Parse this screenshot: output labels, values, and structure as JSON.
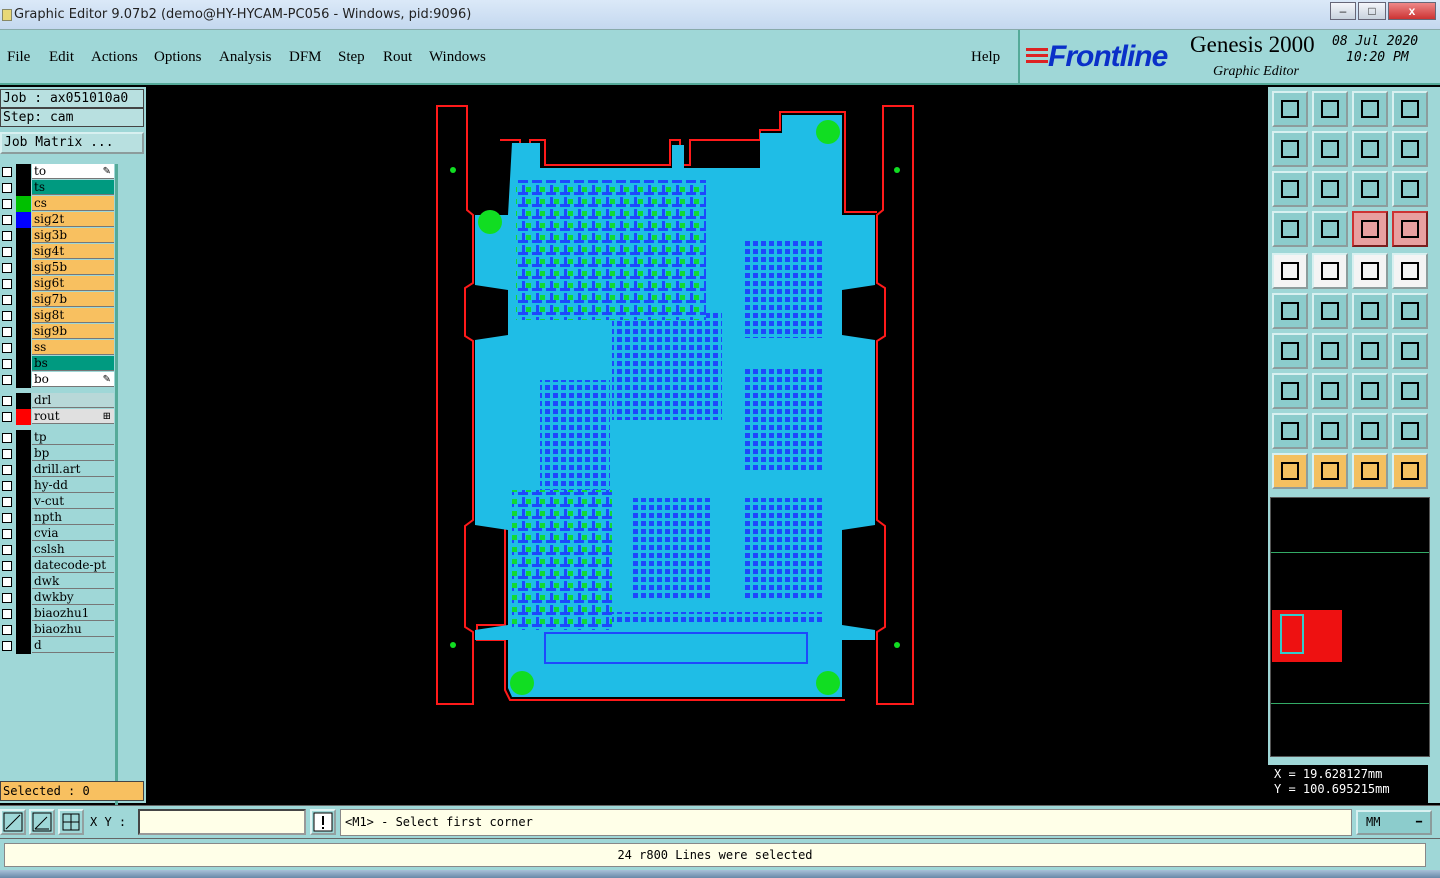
{
  "window": {
    "title": "Graphic Editor 9.07b2 (demo@HY-HYCAM-PC056 - Windows, pid:9096)",
    "minimize": "–",
    "maximize": "□",
    "close": "x"
  },
  "menu": {
    "file": "File",
    "edit": "Edit",
    "actions": "Actions",
    "options": "Options",
    "analysis": "Analysis",
    "dfm": "DFM",
    "step": "Step",
    "rout": "Rout",
    "windows": "Windows",
    "help": "Help"
  },
  "brand": {
    "logo": "Frontline",
    "product": "Genesis 2000",
    "module": "Graphic Editor",
    "date": "08 Jul 2020",
    "time": "10:20 PM"
  },
  "job": {
    "job_line": "Job : ax051010a0",
    "step_line": "Step: cam",
    "matrix_button": "Job Matrix ..."
  },
  "layers": [
    {
      "name": "to",
      "color": "#ffffff",
      "swatch": "#000000",
      "flag": "pen"
    },
    {
      "name": "ts",
      "color": "#009a80",
      "swatch": "#000000"
    },
    {
      "name": "cs",
      "color": "#f8c060",
      "swatch": "#00c000"
    },
    {
      "name": "sig2t",
      "color": "#f8c060",
      "swatch": "#0000ff"
    },
    {
      "name": "sig3b",
      "color": "#f8c060",
      "swatch": "#000000"
    },
    {
      "name": "sig4t",
      "color": "#f8c060",
      "swatch": "#000000"
    },
    {
      "name": "sig5b",
      "color": "#f8c060",
      "swatch": "#000000"
    },
    {
      "name": "sig6t",
      "color": "#f8c060",
      "swatch": "#000000"
    },
    {
      "name": "sig7b",
      "color": "#f8c060",
      "swatch": "#000000"
    },
    {
      "name": "sig8t",
      "color": "#f8c060",
      "swatch": "#000000"
    },
    {
      "name": "sig9b",
      "color": "#f8c060",
      "swatch": "#000000"
    },
    {
      "name": "ss",
      "color": "#f8c060",
      "swatch": "#000000"
    },
    {
      "name": "bs",
      "color": "#009a80",
      "swatch": "#000000"
    },
    {
      "name": "bo",
      "color": "#ffffff",
      "swatch": "#000000",
      "flag": "pen"
    }
  ],
  "drill_layers": [
    {
      "name": "drl",
      "color": "#b8d8d8",
      "swatch": "#000000"
    },
    {
      "name": "rout",
      "color": "#e0e0e0",
      "swatch": "#ff0000",
      "flag": "grid"
    }
  ],
  "misc_layers": [
    {
      "name": "tp"
    },
    {
      "name": "bp"
    },
    {
      "name": "drill.art"
    },
    {
      "name": "hy-dd"
    },
    {
      "name": "v-cut"
    },
    {
      "name": "npth"
    },
    {
      "name": "cvia"
    },
    {
      "name": "cslsh"
    },
    {
      "name": "datecode-pt"
    },
    {
      "name": "dwk"
    },
    {
      "name": "dwkby"
    },
    {
      "name": "biaozhu1"
    },
    {
      "name": "biaozhu"
    },
    {
      "name": "d"
    }
  ],
  "selected": "Selected : 0",
  "coords": {
    "x": "X  =  19.628127mm",
    "y": "Y  =  100.695215mm"
  },
  "status": {
    "xy_label": "X Y :",
    "xy_value": "",
    "prompt": "<M1> - Select first corner",
    "unit": "MM",
    "unit_arrow": "━",
    "result": "24 r800 Lines were selected"
  },
  "toolbar_groups": {
    "view": [
      "home-icon",
      "save-icon",
      "house-icon",
      "window-icon",
      "move-left-icon",
      "move-right-icon",
      "undo-icon",
      "redo-icon",
      "zoom-fit-icon",
      "zoom-center-icon",
      "ratio-icon",
      "query-icon",
      "measure-icon",
      "snap-icon",
      "net-red-icon",
      "net-red2-icon"
    ],
    "edit": [
      "box-select-icon",
      "polygon-icon",
      "ruler-icon",
      "circle-icon",
      "node-icon",
      "cross-icon",
      "line-dot-icon",
      "line-dot2-icon",
      "angle-icon",
      "slash-icon",
      "arc-icon",
      "split-icon",
      "box-node-icon",
      "dash-icon",
      "resize-icon",
      "copy-icon",
      "triangle1-icon",
      "triangle2-icon",
      "triangle3-icon",
      "triangle4-icon",
      "arrow1-icon",
      "arrow2-icon",
      "arrow3-icon",
      "arrow4-icon"
    ]
  },
  "colors": {
    "panel": "#9fd7d7",
    "board": "#1fbde6",
    "copper_blue": "#1e3cff",
    "green_pad": "#11dd22",
    "rout_red": "#ff1a1a"
  }
}
